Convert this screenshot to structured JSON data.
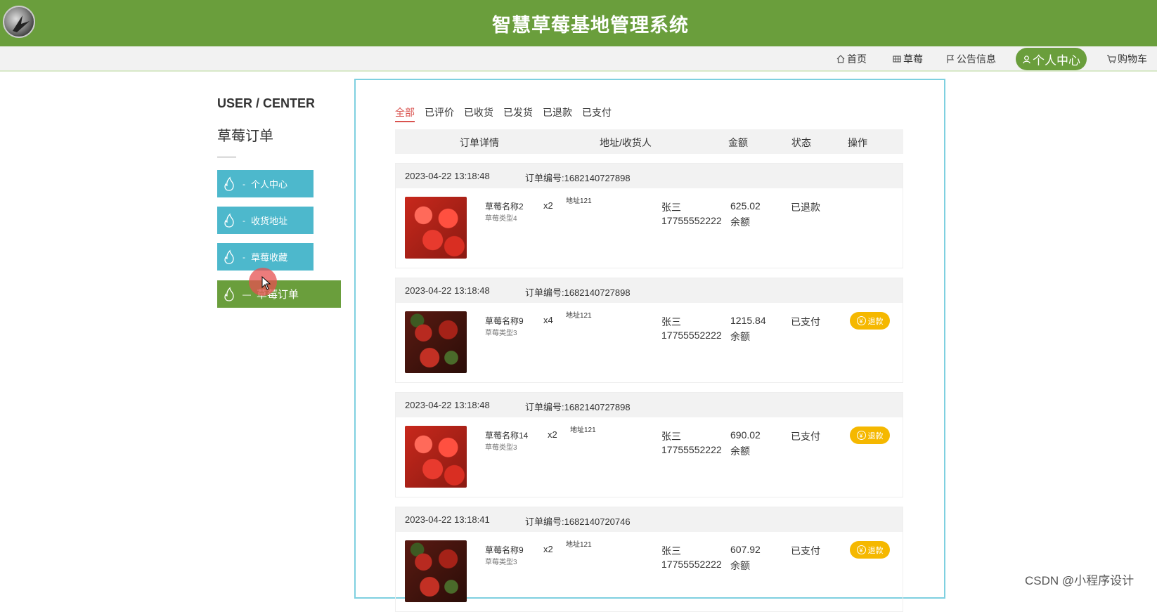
{
  "header": {
    "title": "智慧草莓基地管理系统"
  },
  "nav": {
    "items": [
      {
        "label": "首页",
        "icon": "home-icon"
      },
      {
        "label": "草莓",
        "icon": "grid-icon"
      },
      {
        "label": "公告信息",
        "icon": "flag-icon"
      },
      {
        "label": "个人中心",
        "icon": "user-icon"
      },
      {
        "label": "购物车",
        "icon": "cart-icon"
      }
    ]
  },
  "sidebar": {
    "heading": "USER / CENTER",
    "subtitle": "草莓订单",
    "items": [
      {
        "label": "个人中心"
      },
      {
        "label": "收货地址"
      },
      {
        "label": "草莓收藏"
      },
      {
        "label": "草莓订单"
      }
    ]
  },
  "tabs": [
    "全部",
    "已评价",
    "已收货",
    "已发货",
    "已退款",
    "已支付"
  ],
  "table": {
    "headers": [
      "订单详情",
      "地址/收货人",
      "金额",
      "状态",
      "操作"
    ]
  },
  "orders": [
    {
      "time": "2023-04-22 13:18:48",
      "order_no": "订单编号:1682140727898",
      "name": "草莓名称2",
      "type": "草莓类型4",
      "qty": "x2",
      "address": "地址121",
      "receiver": "张三",
      "phone": "17755552222",
      "amount": "625.02",
      "pay": "余额",
      "status": "已退款",
      "action": ""
    },
    {
      "time": "2023-04-22 13:18:48",
      "order_no": "订单编号:1682140727898",
      "name": "草莓名称9",
      "type": "草莓类型3",
      "qty": "x4",
      "address": "地址121",
      "receiver": "张三",
      "phone": "17755552222",
      "amount": "1215.84",
      "pay": "余额",
      "status": "已支付",
      "action": "退款"
    },
    {
      "time": "2023-04-22 13:18:48",
      "order_no": "订单编号:1682140727898",
      "name": "草莓名称14",
      "type": "草莓类型3",
      "qty": "x2",
      "address": "地址121",
      "receiver": "张三",
      "phone": "17755552222",
      "amount": "690.02",
      "pay": "余额",
      "status": "已支付",
      "action": "退款"
    },
    {
      "time": "2023-04-22 13:18:41",
      "order_no": "订单编号:1682140720746",
      "name": "草莓名称9",
      "type": "草莓类型3",
      "qty": "x2",
      "address": "地址121",
      "receiver": "张三",
      "phone": "17755552222",
      "amount": "607.92",
      "pay": "余额",
      "status": "已支付",
      "action": "退款"
    }
  ],
  "watermark": "CSDN @小程序设计",
  "colors": {
    "brand_green": "#6a9e3c",
    "sidebar_blue": "#4db8cc",
    "refund_yellow": "#f5b800",
    "tab_active": "#d9534f"
  }
}
